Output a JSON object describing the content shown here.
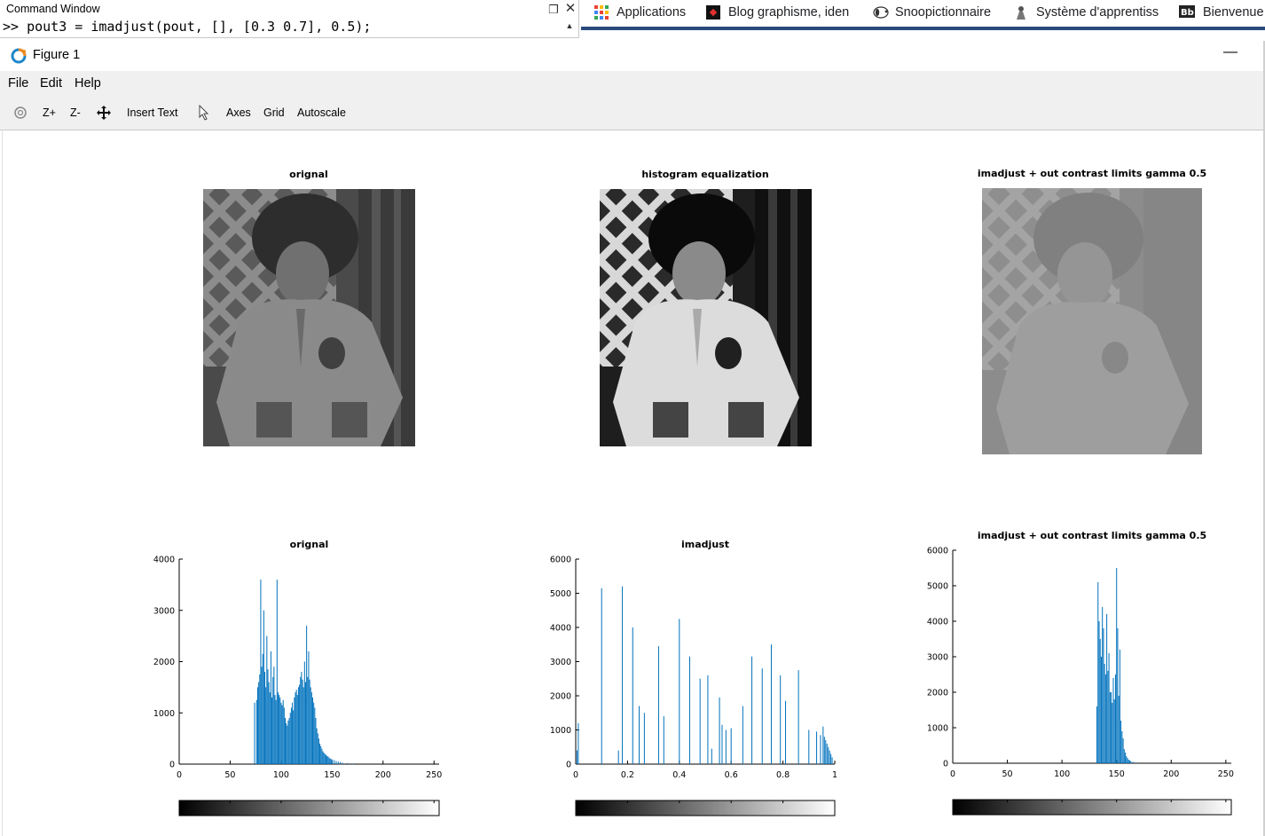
{
  "command_window": {
    "title": "Command Window",
    "command": ">> pout3 = imadjust(pout, [], [0.3 0.7], 0.5);"
  },
  "bookmarks": [
    {
      "label": "Applications",
      "icon": "apps-grid-icon"
    },
    {
      "label": "Blog graphisme, iden",
      "icon": "blog-icon"
    },
    {
      "label": "Snoopictionnaire",
      "icon": "snoopy-icon"
    },
    {
      "label": "Système d'apprentiss",
      "icon": "learning-system-icon"
    },
    {
      "label": "Bienvenue",
      "icon": "blackboard-icon"
    }
  ],
  "figure": {
    "title": "Figure 1",
    "menu": [
      "File",
      "Edit",
      "Help"
    ],
    "toolbar": [
      "Z+",
      "Z-",
      "Insert Text",
      "Axes",
      "Grid",
      "Autoscale"
    ]
  },
  "images": [
    {
      "title": "orignal",
      "tone": "original"
    },
    {
      "title": "histogram equalization",
      "tone": "equalized"
    },
    {
      "title": "imadjust + out contrast limits gamma 0.5",
      "tone": "adjusted"
    }
  ],
  "chart_data": [
    {
      "type": "bar",
      "title": "orignal",
      "xlim": [
        0,
        255
      ],
      "ylim": [
        0,
        4000
      ],
      "xticks": [
        0,
        50,
        100,
        150,
        200,
        250
      ],
      "yticks": [
        0,
        1000,
        2000,
        3000,
        4000
      ],
      "color": "#0072BD",
      "colorbar": "grayscale",
      "x": [
        74,
        76,
        77,
        78,
        79,
        80,
        81,
        82,
        83,
        84,
        85,
        86,
        87,
        88,
        89,
        90,
        91,
        92,
        93,
        94,
        95,
        96,
        97,
        98,
        99,
        100,
        101,
        102,
        103,
        104,
        105,
        106,
        107,
        108,
        109,
        110,
        111,
        112,
        113,
        114,
        115,
        116,
        117,
        118,
        119,
        120,
        121,
        122,
        123,
        124,
        125,
        126,
        127,
        128,
        129,
        130,
        131,
        132,
        133,
        134,
        135,
        136,
        137,
        138,
        139,
        140,
        141,
        142,
        143,
        144,
        145,
        146,
        147,
        148,
        149,
        150,
        152,
        154,
        156,
        158,
        160,
        165,
        170
      ],
      "values": [
        1200,
        1250,
        1500,
        1600,
        1750,
        3600,
        1900,
        2150,
        3000,
        1800,
        1500,
        2500,
        1850,
        1600,
        1400,
        2200,
        1300,
        1700,
        1900,
        1350,
        1250,
        3600,
        1400,
        1350,
        1300,
        1200,
        1150,
        1250,
        1100,
        900,
        800,
        750,
        850,
        900,
        1000,
        1100,
        1200,
        1050,
        1300,
        1400,
        1450,
        1350,
        1500,
        1550,
        1700,
        1800,
        1650,
        1500,
        2000,
        1600,
        2700,
        1700,
        2200,
        1650,
        1500,
        1400,
        1300,
        1200,
        1100,
        900,
        700,
        600,
        500,
        400,
        350,
        300,
        250,
        220,
        200,
        180,
        160,
        150,
        130,
        110,
        100,
        90,
        80,
        60,
        50,
        40,
        30,
        20,
        10
      ]
    },
    {
      "type": "bar",
      "title": "imadjust",
      "xlim": [
        0,
        1
      ],
      "ylim": [
        0,
        6000
      ],
      "xticks": [
        0,
        0.2,
        0.4,
        0.6,
        0.8,
        1
      ],
      "yticks": [
        0,
        1000,
        2000,
        3000,
        4000,
        5000,
        6000
      ],
      "color": "#0072BD",
      "colorbar": "grayscale",
      "x": [
        0.005,
        0.01,
        0.1,
        0.165,
        0.18,
        0.22,
        0.245,
        0.265,
        0.32,
        0.34,
        0.4,
        0.44,
        0.48,
        0.51,
        0.525,
        0.555,
        0.565,
        0.58,
        0.6,
        0.645,
        0.68,
        0.72,
        0.755,
        0.79,
        0.81,
        0.86,
        0.9,
        0.93,
        0.945,
        0.955,
        0.96,
        0.965,
        0.97,
        0.975,
        0.98,
        0.985,
        0.99
      ],
      "values": [
        400,
        1200,
        5150,
        400,
        5200,
        4000,
        1700,
        1500,
        3450,
        1400,
        4250,
        3150,
        2500,
        2600,
        450,
        1950,
        1150,
        1000,
        1050,
        1700,
        3150,
        2800,
        3500,
        2600,
        1850,
        2750,
        1000,
        950,
        850,
        1100,
        800,
        700,
        600,
        500,
        400,
        300,
        200
      ]
    },
    {
      "type": "bar",
      "title": "imadjust + out contrast limits gamma 0.5",
      "xlim": [
        0,
        255
      ],
      "ylim": [
        0,
        6000
      ],
      "xticks": [
        0,
        50,
        100,
        150,
        200,
        250
      ],
      "yticks": [
        0,
        1000,
        2000,
        3000,
        4000,
        5000,
        6000
      ],
      "color": "#0072BD",
      "colorbar": "grayscale",
      "x": [
        132,
        133,
        134,
        135,
        136,
        137,
        138,
        139,
        140,
        141,
        142,
        143,
        144,
        145,
        146,
        147,
        148,
        149,
        150,
        151,
        152,
        153,
        154,
        155,
        156,
        157,
        158,
        159,
        160,
        161,
        162,
        163,
        165,
        168
      ],
      "values": [
        1600,
        5100,
        4000,
        3500,
        3000,
        4400,
        3800,
        2800,
        2500,
        4200,
        2600,
        3100,
        2000,
        2000,
        1700,
        2400,
        1800,
        2500,
        5500,
        3800,
        1900,
        3200,
        1200,
        900,
        700,
        400,
        300,
        200,
        150,
        100,
        80,
        60,
        40,
        20
      ]
    }
  ]
}
